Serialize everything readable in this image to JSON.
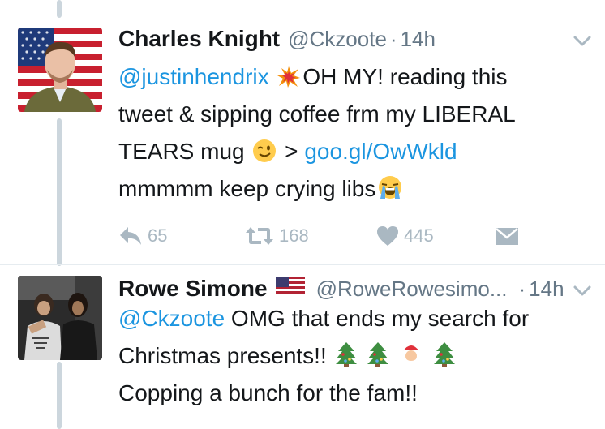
{
  "tweets": [
    {
      "display_name": "Charles Knight",
      "handle": "@Ckzoote",
      "separator": "·",
      "time": "14h",
      "mention": "@justinhendrix",
      "text_1": "OH MY! reading this",
      "text_2": "tweet & sipping coffee frm my LIBERAL",
      "text_3a": "TEARS mug",
      "text_3b": ">",
      "link": "goo.gl/OwWkld",
      "text_4": "mmmmm keep crying libs",
      "reply_count": "65",
      "retweet_count": "168",
      "like_count": "445",
      "icons": [
        "collision-emoji",
        "winking-face-emoji",
        "loudly-crying-face-emoji",
        "reply-icon",
        "retweet-icon",
        "heart-icon",
        "direct-message-icon",
        "chevron-down-icon"
      ]
    },
    {
      "display_name": "Rowe Simone",
      "handle": "@RoweRowesimo...",
      "separator": "·",
      "time": "14h",
      "mention": "@Ckzoote",
      "text_1": "OMG that ends my search for",
      "text_2": "Christmas presents!!",
      "text_3": "Copping a bunch for the fam!!",
      "icons": [
        "us-flag-emoji",
        "christmas-tree-emoji",
        "santa-emoji",
        "chevron-down-icon"
      ]
    }
  ],
  "colors": {
    "link": "#1b95e0",
    "secondary_text": "#657786",
    "action_icon": "#aab8c2",
    "thread_line": "#ccd6dd"
  }
}
